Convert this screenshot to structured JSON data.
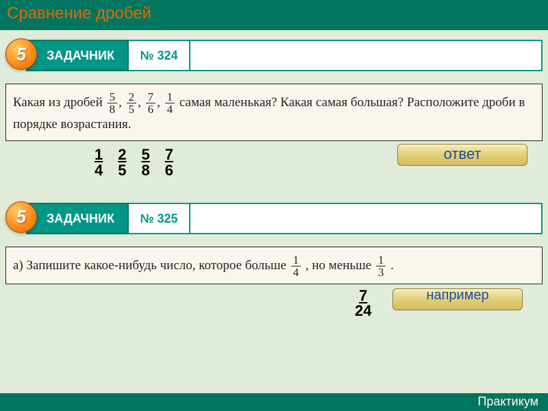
{
  "header": {
    "title": "Сравнение дробей"
  },
  "badge": {
    "number": "5"
  },
  "task1": {
    "label": "ЗАДАЧНИК",
    "number": "№ 324",
    "problem_pre": "Какая из дробей ",
    "fractions": [
      {
        "n": "5",
        "d": "8"
      },
      {
        "n": "2",
        "d": "5"
      },
      {
        "n": "7",
        "d": "6"
      },
      {
        "n": "1",
        "d": "4"
      }
    ],
    "problem_mid": " самая маленькая? Какая самая большая? Расположите дроби в порядке возрастания.",
    "answer_fracs": [
      {
        "n": "1",
        "d": "4"
      },
      {
        "n": "2",
        "d": "5"
      },
      {
        "n": "5",
        "d": "8"
      },
      {
        "n": "7",
        "d": "6"
      }
    ],
    "answer_button": "ответ"
  },
  "task2": {
    "label": "ЗАДАЧНИК",
    "number": "№ 325",
    "problem_prefix": "а) Запишите какое-нибудь число, которое больше ",
    "frac1": {
      "n": "1",
      "d": "4"
    },
    "problem_mid": ", но меньше ",
    "frac2": {
      "n": "1",
      "d": "3"
    },
    "problem_suffix": ".",
    "example_frac": {
      "n": "7",
      "d": "24"
    },
    "example_button": "например"
  },
  "footer": {
    "text": "Практикум"
  }
}
